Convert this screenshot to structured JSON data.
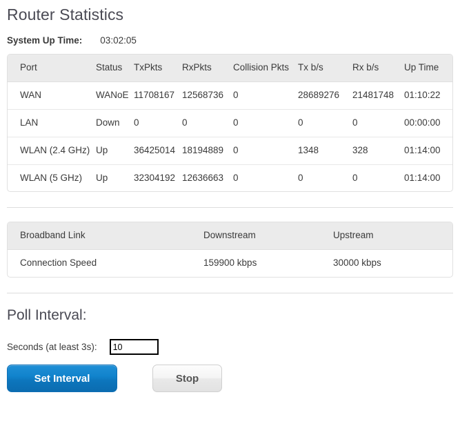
{
  "header": {
    "title": "Router Statistics",
    "uptime_label": "System Up Time:",
    "uptime_value": "03:02:05"
  },
  "stats_table": {
    "columns": [
      "Port",
      "Status",
      "TxPkts",
      "RxPkts",
      "Collision Pkts",
      "Tx b/s",
      "Rx b/s",
      "Up Time"
    ],
    "rows": [
      {
        "port": "WAN",
        "status": "WANoE",
        "tx_pkts": "11708167",
        "rx_pkts": "12568736",
        "collision_pkts": "0",
        "tx_bs": "28689276",
        "rx_bs": "21481748",
        "up_time": "01:10:22"
      },
      {
        "port": "LAN",
        "status": "Down",
        "tx_pkts": "0",
        "rx_pkts": "0",
        "collision_pkts": "0",
        "tx_bs": "0",
        "rx_bs": "0",
        "up_time": "00:00:00"
      },
      {
        "port": "WLAN (2.4 GHz)",
        "status": "Up",
        "tx_pkts": "36425014",
        "rx_pkts": "18194889",
        "collision_pkts": "0",
        "tx_bs": "1348",
        "rx_bs": "328",
        "up_time": "01:14:00"
      },
      {
        "port": "WLAN (5 GHz)",
        "status": "Up",
        "tx_pkts": "32304192",
        "rx_pkts": "12636663",
        "collision_pkts": "0",
        "tx_bs": "0",
        "rx_bs": "0",
        "up_time": "01:14:00"
      }
    ]
  },
  "broadband_table": {
    "columns": [
      "Broadband Link",
      "Downstream",
      "Upstream"
    ],
    "rows": [
      {
        "link": "Connection Speed",
        "downstream": "159900 kbps",
        "upstream": "30000 kbps"
      }
    ]
  },
  "poll_interval": {
    "title": "Poll Interval:",
    "seconds_label": "Seconds (at least 3s):",
    "seconds_value": "10",
    "set_button": "Set Interval",
    "stop_button": "Stop"
  },
  "colors": {
    "primary_button": "#1183cc",
    "table_header_bg": "#ebebeb",
    "text": "#3a3a3a",
    "heading": "#4a4a54",
    "border": "#e0e0e0"
  }
}
